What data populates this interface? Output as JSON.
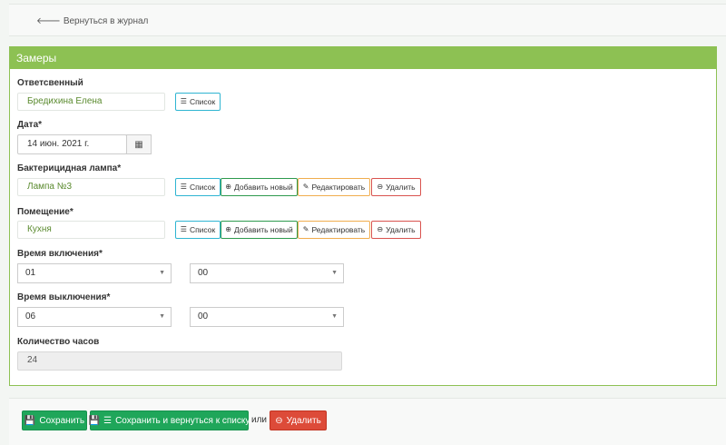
{
  "nav": {
    "back_label": "Вернуться в журнал"
  },
  "panel": {
    "title": "Замеры"
  },
  "form": {
    "responsible": {
      "label": "Ответсвенный",
      "value": "Бредихина Елена",
      "list_button": "Список"
    },
    "date": {
      "label": "Дата*",
      "value": "14 июн. 2021 г."
    },
    "lamp": {
      "label": "Бактерицидная лампа*",
      "value": "Лампа №3",
      "list_button": "Список",
      "add_button": "Добавить новый",
      "edit_button": "Редактировать",
      "delete_button": "Удалить"
    },
    "room": {
      "label": "Помещение*",
      "value": "Кухня",
      "list_button": "Список",
      "add_button": "Добавить новый",
      "edit_button": "Редактировать",
      "delete_button": "Удалить"
    },
    "on_time": {
      "label": "Время включения*",
      "hour": "01",
      "minute": "00"
    },
    "off_time": {
      "label": "Время выключения*",
      "hour": "06",
      "minute": "00"
    },
    "hours_count": {
      "label": "Количество часов",
      "value": "24"
    }
  },
  "footer": {
    "save_label": "Сохранить",
    "save_return_label": "Сохранить и вернуться к списку",
    "or_label": "или",
    "delete_label": "Удалить"
  },
  "colors": {
    "panel_header": "#8dc153",
    "success": "#1fa65a",
    "danger": "#dd4b39",
    "info_border": "#2fb5d2",
    "warning_border": "#f0ad4e"
  }
}
